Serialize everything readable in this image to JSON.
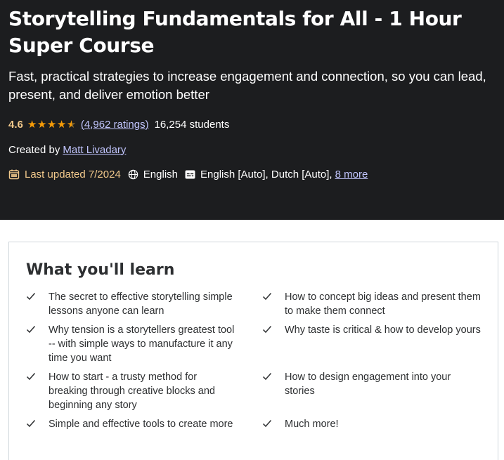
{
  "course": {
    "title": "Storytelling Fundamentals for All - 1 Hour Super Course",
    "subtitle": "Fast, practical strategies to increase engagement and connection, so you can lead, present, and deliver emotion better",
    "rating": "4.6",
    "rating_value_of_5": 4.6,
    "ratings_count": "(4,962 ratings)",
    "students": "16,254 students",
    "created_by_label": "Created by",
    "author": "Matt Livadary",
    "last_updated": "Last updated 7/2024",
    "language": "English",
    "captions": "English [Auto], Dutch [Auto],",
    "captions_more": "8 more"
  },
  "learn": {
    "title": "What you'll learn",
    "left": [
      "The secret to effective storytelling simple lessons anyone can learn",
      "Why tension is a storytellers greatest tool -- with simple ways to manufacture it any time you want",
      "How to start - a trusty method for breaking through creative blocks and beginning any story",
      "Simple and effective tools to create more"
    ],
    "right": [
      "How to concept big ideas and present them to make them connect",
      "Why taste is critical & how to develop yours",
      "How to design engagement into your stories",
      "Much more!"
    ]
  },
  "icons": {
    "updated": "calendar-icon",
    "language": "globe-icon",
    "captions": "closed-captions-icon",
    "check": "check-icon"
  },
  "colors": {
    "hero_bg": "#1c1d1f",
    "rating": "#f3ca8c",
    "star": "#f69c08",
    "link": "#c0c4fc"
  }
}
